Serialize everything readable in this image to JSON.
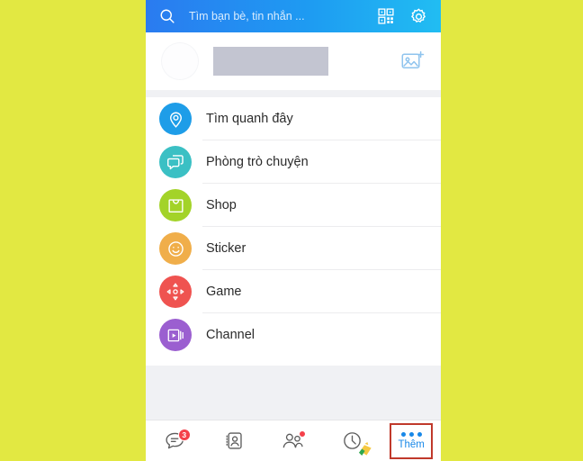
{
  "app": {
    "background_color": "#e2e842",
    "panel_color": "#ffffff"
  },
  "header": {
    "search_icon": "search-icon",
    "placeholder": "Tìm bạn bè, tin nhắn ...",
    "qr_icon": "qr-code-icon",
    "settings_icon": "gear-icon",
    "gradient_start": "#2a7bf0",
    "gradient_end": "#21bdf2"
  },
  "profile": {
    "avatar_icon": "avatar",
    "name_redacted": "",
    "add_photo_icon": "add-photo-icon"
  },
  "menu": {
    "items": [
      {
        "label": "Tìm quanh đây",
        "icon": "location-pin-icon",
        "color": "#1e9de8"
      },
      {
        "label": "Phòng trò chuyện",
        "icon": "chat-bubble-icon",
        "color": "#3bc0c4"
      },
      {
        "label": "Shop",
        "icon": "shopping-bag-icon",
        "color": "#a3d329"
      },
      {
        "label": "Sticker",
        "icon": "smiley-icon",
        "color": "#f0ae4a"
      },
      {
        "label": "Game",
        "icon": "dpad-icon",
        "color": "#ef5350"
      },
      {
        "label": "Channel",
        "icon": "video-channel-icon",
        "color": "#9b5fd0"
      }
    ]
  },
  "bottom_nav": {
    "items": [
      {
        "name": "messages",
        "icon": "chat-bubble-icon",
        "badge": "3",
        "label": ""
      },
      {
        "name": "contacts",
        "icon": "contact-card-icon",
        "badge": "",
        "label": ""
      },
      {
        "name": "friends",
        "icon": "people-icon",
        "badge": "•",
        "label": ""
      },
      {
        "name": "timeline",
        "icon": "clock-icon",
        "badge": "",
        "label": ""
      },
      {
        "name": "more",
        "icon": "three-dots-icon",
        "badge": "",
        "label": "Thêm"
      }
    ],
    "highlight_color": "#c0392b",
    "more_accent_color": "#1888e8",
    "badge_color": "#f4404a"
  },
  "cursor": {
    "icon": "hand-cursor"
  }
}
